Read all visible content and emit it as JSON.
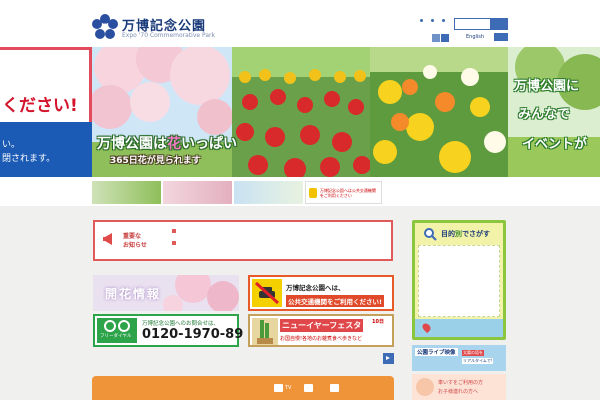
{
  "header": {
    "title": "万博記念公園",
    "subtitle": "Expo '70 Commemorative Park",
    "lang_link": "English"
  },
  "hero": {
    "notice_line1": "ください!",
    "notice_line2": "い。",
    "notice_line3": "閉されます。",
    "copy_main_prefix": "万博公園は",
    "copy_main_highlight": "花",
    "copy_main_suffix": "いっぱい",
    "copy_sub": "365日花が見られます",
    "slide4_line1": "万博公園に",
    "slide4_line2": "みんなで",
    "slide4_line3": "イベントが"
  },
  "thumb_strip": {
    "thumb3_text": "万博記念公園へは公共交通機関をご利用ください"
  },
  "news": {
    "label_line1": "重要な",
    "label_line2": "お知らせ"
  },
  "banners": {
    "kaika": "開花情報",
    "transit_line1": "万博記念公園へは、",
    "transit_line2": "公共交通機関をご利用ください!",
    "free_icon_label": "フリーダイヤル",
    "free_line1": "万博記念公園へのお問合せは、",
    "free_number": "0120-1970-89",
    "newyear_title": "ニューイヤーフェスタ",
    "newyear_date": "10日",
    "newyear_sub": "お国自慢!各地のお雑煮食べ歩きなど"
  },
  "purpose": {
    "title_prefix": "目的",
    "title_highlight": "別",
    "title_suffix": "でさがす"
  },
  "live": {
    "title": "公園ライブ映像",
    "tag1": "太陽の塔を",
    "tag2": "リアルタイムで!"
  },
  "guide": {
    "line1": "車いすをご利用の方",
    "line2": "お子様連れの方へ"
  },
  "bottom_bar": {
    "item1": "TV",
    "item2": "",
    "item3": ""
  },
  "colors": {
    "brand_blue": "#1a3a7a",
    "accent_red": "#e24b5c",
    "accent_green": "#8cc63f",
    "accent_orange": "#f0943a"
  }
}
